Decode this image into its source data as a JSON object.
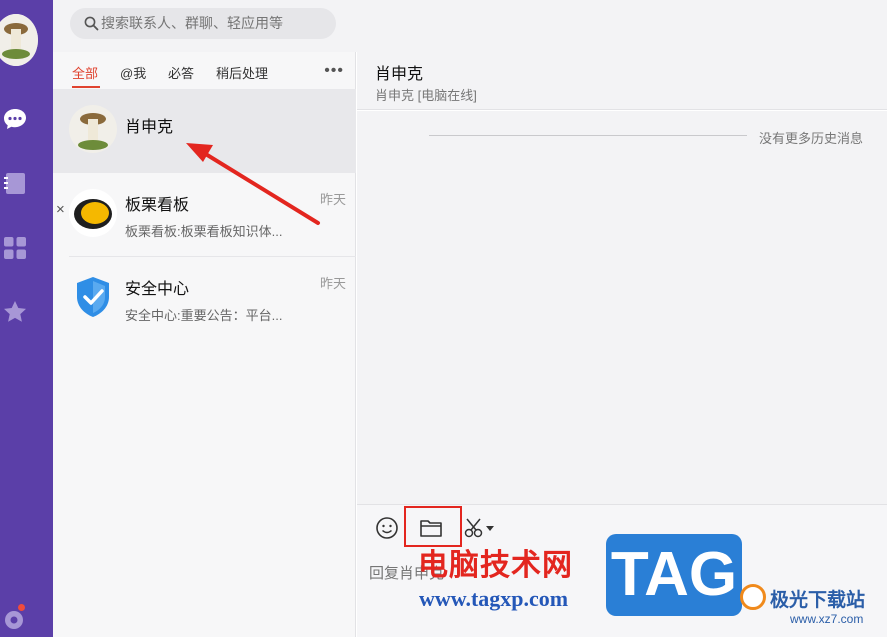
{
  "search": {
    "placeholder": "搜索联系人、群聊、轻应用等"
  },
  "tabs": [
    {
      "label": "全部",
      "active": true
    },
    {
      "label": "@我",
      "active": false
    },
    {
      "label": "必答",
      "active": false
    },
    {
      "label": "稍后处理",
      "active": false
    }
  ],
  "more_label": "•••",
  "conversations": [
    {
      "name": "肖申克",
      "preview": "",
      "time": "",
      "selected": true
    },
    {
      "name": "板栗看板",
      "preview": "板栗看板:板栗看板知识体...",
      "time": "昨天",
      "selected": false
    },
    {
      "name": "安全中心",
      "preview": "安全中心:重要公告：平台...",
      "time": "昨天",
      "selected": false
    }
  ],
  "close_glyph": "×",
  "chat": {
    "title": "肖申克",
    "status": "肖申克 [电脑在线]",
    "history_notice": "没有更多历史消息"
  },
  "input": {
    "placeholder": "回复肖申克"
  },
  "watermark": {
    "cn_text": "电脑技术网",
    "url": "www.tagxp.com",
    "tag": "TAG",
    "site_name": "极光下载站",
    "site_url": "www.xz7.com"
  },
  "colors": {
    "rail": "#5b3fa8",
    "accent": "#e0432f",
    "annotation": "#e3261f"
  }
}
